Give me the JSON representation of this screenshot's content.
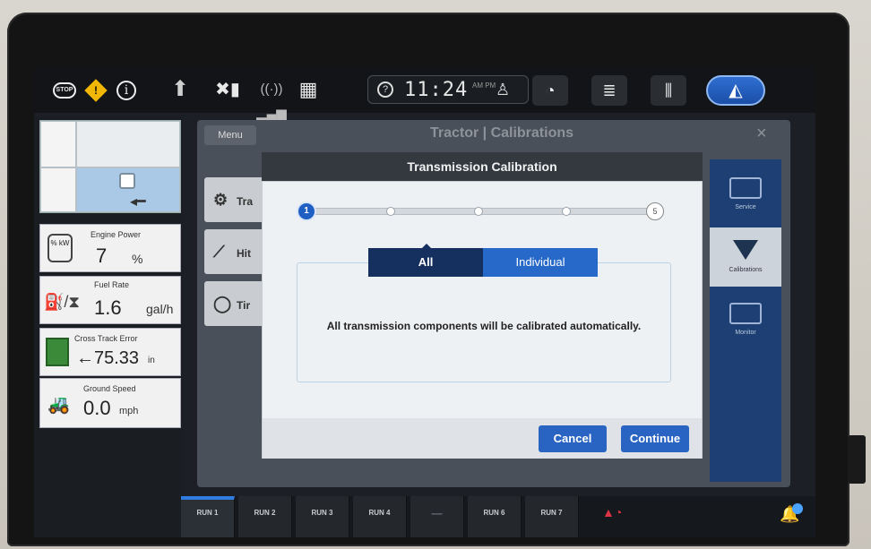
{
  "status_bar": {
    "stop_label": "STOP",
    "time": "11:24",
    "ampm": "AM PM",
    "icons": [
      "stop-icon",
      "warning-icon",
      "info-icon",
      "up-arrow-icon",
      "gps-icon",
      "wifi-signal-icon",
      "grid-icon",
      "help-icon",
      "user-icon",
      "gauge-icon",
      "field-icon",
      "crop-icon",
      "navigation-icon"
    ],
    "colors": {
      "warning": "#f2b705",
      "nav_button": "#2f6fd0"
    }
  },
  "widgets": {
    "engine_power": {
      "title": "Engine Power",
      "value": "7",
      "unit": "%",
      "icon_label": "% kW"
    },
    "fuel_rate": {
      "title": "Fuel Rate",
      "value": "1.6",
      "unit": "gal/h"
    },
    "cross_track": {
      "title": "Cross Track Error",
      "value": "←75.33",
      "unit": "in"
    },
    "ground_speed": {
      "title": "Ground Speed",
      "value": "0.0",
      "unit": "mph"
    }
  },
  "app": {
    "menu_label": "Menu",
    "title": "Tractor | Calibrations",
    "close_label": "×",
    "list": [
      {
        "label": "Tra",
        "icon": "gear-icon"
      },
      {
        "label": "Hit",
        "icon": "hitch-icon"
      },
      {
        "label": "Tir",
        "icon": "tire-icon"
      }
    ],
    "right_nav": [
      {
        "label": "Service"
      },
      {
        "label": "Calibrations"
      },
      {
        "label": "Monitor"
      }
    ]
  },
  "modal": {
    "title": "Transmission Calibration",
    "step_current": "1",
    "step_total": "5",
    "segments": {
      "all": "All",
      "individual": "Individual"
    },
    "message": "All transmission components will be calibrated automatically.",
    "cancel_label": "Cancel",
    "continue_label": "Continue"
  },
  "run_bar": {
    "tabs": [
      "RUN 1",
      "RUN 2",
      "RUN 3",
      "RUN 4",
      "—",
      "RUN 6",
      "RUN 7"
    ],
    "active_index": 0
  }
}
